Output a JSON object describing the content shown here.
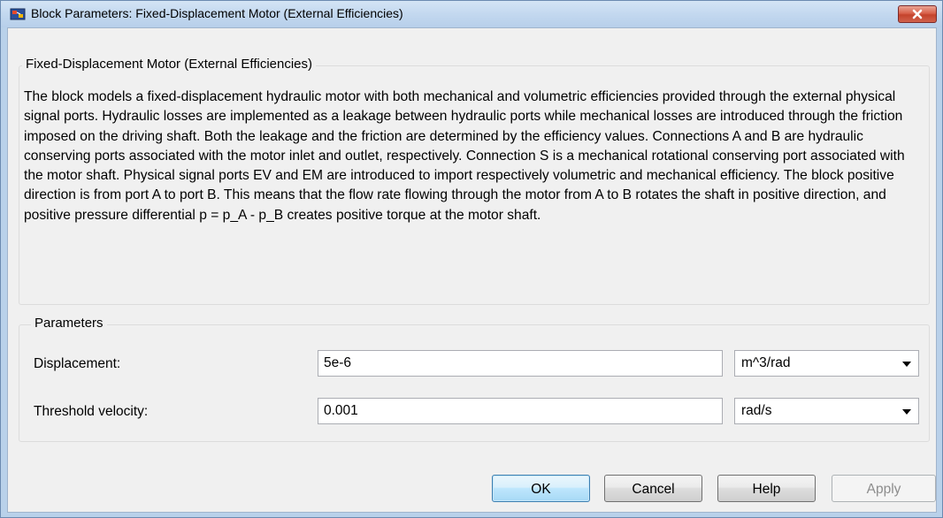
{
  "window": {
    "title": "Block Parameters: Fixed-Displacement Motor (External Efficiencies)",
    "close_glyph": "✕",
    "icon": "simulink-block-icon"
  },
  "description_group": {
    "title": "Fixed-Displacement Motor (External Efficiencies)",
    "text": "The block models a fixed-displacement hydraulic motor with both mechanical and volumetric efficiencies provided through the external physical signal ports. Hydraulic losses are implemented as a leakage between hydraulic ports while mechanical losses are introduced through the friction imposed on the driving shaft. Both the leakage and the friction are determined by the efficiency values. Connections A and B are hydraulic conserving ports associated with the motor inlet and outlet, respectively. Connection S is a mechanical rotational conserving port associated with the motor shaft. Physical signal ports EV and EM are introduced to import respectively volumetric and mechanical efficiency. The block positive direction is from port A to port B. This means that the flow rate flowing through the motor from A to B rotates the shaft in positive direction, and positive pressure differential p = p_A - p_B creates positive torque at the motor shaft."
  },
  "parameters_group": {
    "title": "Parameters",
    "displacement": {
      "label": "Displacement:",
      "value": "5e-6",
      "unit": "m^3/rad"
    },
    "threshold_velocity": {
      "label": "Threshold velocity:",
      "value": "0.001",
      "unit": "rad/s"
    }
  },
  "buttons": {
    "ok": "OK",
    "cancel": "Cancel",
    "help": "Help",
    "apply": "Apply"
  },
  "colors": {
    "frame": "#b9d1ea",
    "client": "#f0f0f0",
    "close_button": "#c4432c",
    "default_button_border": "#3c7fb1"
  }
}
